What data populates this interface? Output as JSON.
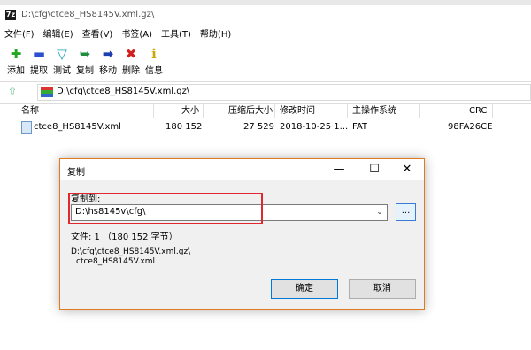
{
  "window": {
    "title": "D:\\cfg\\ctce8_HS8145V.xml.gz\\",
    "app_icon_label": "7z"
  },
  "menu": [
    "文件(F)",
    "编辑(E)",
    "查看(V)",
    "书签(A)",
    "工具(T)",
    "帮助(H)"
  ],
  "toolbar": [
    {
      "label": "添加",
      "icon": "add-icon",
      "glyph": "✚",
      "color": "#22a722"
    },
    {
      "label": "提取",
      "icon": "extract-icon",
      "glyph": "▬",
      "color": "#2b4fcf"
    },
    {
      "label": "测试",
      "icon": "test-icon",
      "glyph": "▽",
      "color": "#17a2b8"
    },
    {
      "label": "复制",
      "icon": "copy-icon",
      "glyph": "➥",
      "color": "#1e8e3e"
    },
    {
      "label": "移动",
      "icon": "move-icon",
      "glyph": "➡",
      "color": "#1a3faf"
    },
    {
      "label": "删除",
      "icon": "delete-icon",
      "glyph": "✖",
      "color": "#d12020"
    },
    {
      "label": "信息",
      "icon": "info-icon",
      "glyph": "ℹ",
      "color": "#c9a800"
    }
  ],
  "address": {
    "path": "D:\\cfg\\ctce8_HS8145V.xml.gz\\"
  },
  "columns": [
    "名称",
    "大小",
    "压缩后大小",
    "修改时间",
    "主操作系统",
    "CRC"
  ],
  "rows": [
    {
      "name": "ctce8_HS8145V.xml",
      "size": "180 152",
      "packed": "27 529",
      "modified": "2018-10-25 1...",
      "os": "FAT",
      "crc": "98FA26CE"
    }
  ],
  "dialog": {
    "title": "复制",
    "controls": {
      "minimize": "—",
      "maximize": "☐",
      "close": "✕"
    },
    "copy_to_label": "复制到:",
    "destination": "D:\\hs8145v\\cfg\\",
    "browse_label": "...",
    "files_info": "文件: 1 （180 152 字节）",
    "source_line1": "D:\\cfg\\ctce8_HS8145V.xml.gz\\",
    "source_line2": "ctce8_HS8145V.xml",
    "ok_label": "确定",
    "cancel_label": "取消",
    "highlight_color": "#e0282e"
  }
}
